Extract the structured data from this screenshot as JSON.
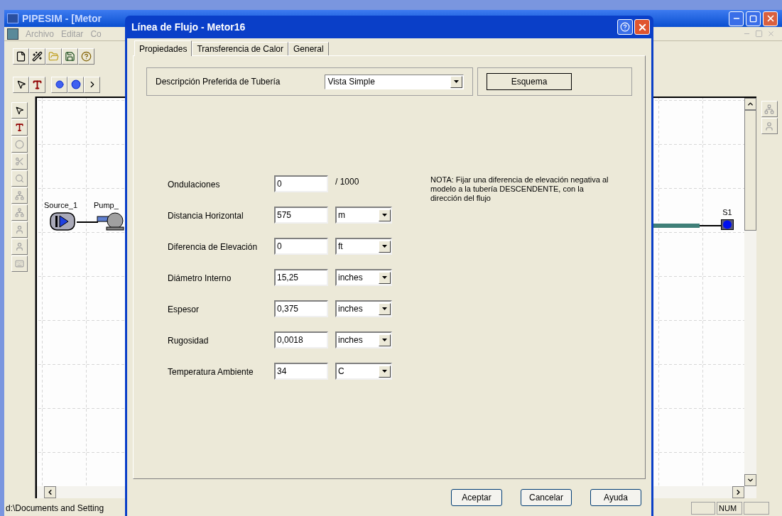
{
  "app": {
    "title": "PIPESIM - [Metor",
    "menu": [
      {
        "label": "Archivo"
      },
      {
        "label": "Editar"
      },
      {
        "label": "Co"
      }
    ]
  },
  "canvas": {
    "nodes": [
      {
        "label": "Source_1",
        "kind": "source"
      },
      {
        "label": "Pump_",
        "kind": "pump"
      },
      {
        "label": "S1",
        "kind": "sink"
      }
    ]
  },
  "status_bar": {
    "path": "d:\\Documents and Setting",
    "indicator": "NUM"
  },
  "dialog": {
    "title": "Línea de Flujo - Metor16",
    "tabs": [
      {
        "label": "Propiedades",
        "selected": true
      },
      {
        "label": "Transferencia de Calor",
        "selected": false
      },
      {
        "label": "General",
        "selected": false
      }
    ],
    "preferred": {
      "label": "Descripción Preferida de Tubería",
      "value": "Vista Simple"
    },
    "schema_button": "Esquema",
    "fields": [
      {
        "label": "Ondulaciones",
        "value": "0",
        "unit": "/ 1000",
        "kind": "text"
      },
      {
        "label": "Distancia Horizontal",
        "value": "575",
        "unit": "m",
        "kind": "select"
      },
      {
        "label": "Diferencia de Elevación",
        "value": "0",
        "unit": "ft",
        "kind": "select"
      },
      {
        "label": "Diámetro Interno",
        "value": "15,25",
        "unit": "inches",
        "kind": "select"
      },
      {
        "label": "Espesor",
        "value": "0,375",
        "unit": "inches",
        "kind": "select"
      },
      {
        "label": "Rugosidad",
        "value": "0,0018",
        "unit": "inches",
        "kind": "select"
      },
      {
        "label": "Temperatura Ambiente",
        "value": "34",
        "unit": "C",
        "kind": "select"
      }
    ],
    "note": "NOTA: Fijar una diferencia de elevación negativa  al modelo a la tubería DESCENDENTE, con la dirección del flujo",
    "buttons": [
      {
        "label": "Aceptar"
      },
      {
        "label": "Cancelar"
      },
      {
        "label": "Ayuda"
      }
    ]
  }
}
